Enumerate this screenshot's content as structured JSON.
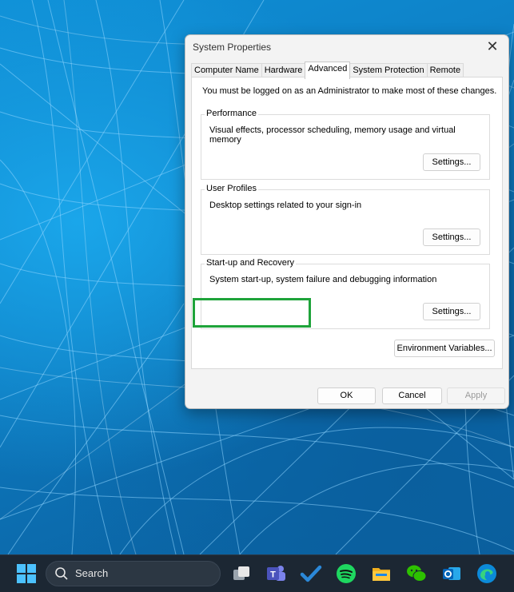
{
  "dialog": {
    "title": "System Properties",
    "close_glyph": "✕",
    "tabs": [
      {
        "label": "Computer Name"
      },
      {
        "label": "Hardware"
      },
      {
        "label": "Advanced"
      },
      {
        "label": "System Protection"
      },
      {
        "label": "Remote"
      }
    ],
    "active_tab": "Advanced",
    "admin_note": "You must be logged on as an Administrator to make most of these changes.",
    "groups": [
      {
        "legend": "Performance",
        "description": "Visual effects, processor scheduling, memory usage and virtual memory",
        "button": "Settings..."
      },
      {
        "legend": "User Profiles",
        "description": "Desktop settings related to your sign-in",
        "button": "Settings..."
      },
      {
        "legend": "Start-up and Recovery",
        "description": "System start-up, system failure and debugging information",
        "button": "Settings..."
      }
    ],
    "env_button": "Environment Variables...",
    "footer": {
      "ok": "OK",
      "cancel": "Cancel",
      "apply": "Apply"
    }
  },
  "taskbar": {
    "search_label": "Search",
    "icons": [
      "windows-start-icon",
      "task-view-icon",
      "teams-icon",
      "todo-icon",
      "spotify-icon",
      "file-explorer-icon",
      "wechat-icon",
      "outlook-icon",
      "edge-icon"
    ]
  },
  "colors": {
    "highlight": "#1fa33a",
    "desktop": "#0b7cc0",
    "taskbar": "#1c2733"
  }
}
